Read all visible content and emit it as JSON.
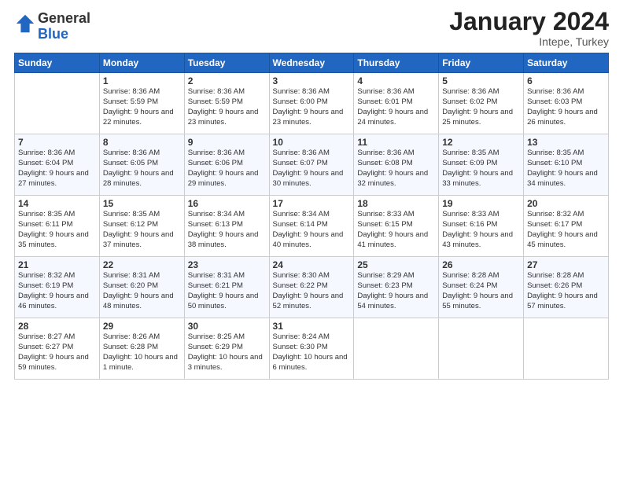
{
  "header": {
    "logo_general": "General",
    "logo_blue": "Blue",
    "month_title": "January 2024",
    "subtitle": "Intepe, Turkey"
  },
  "columns": [
    "Sunday",
    "Monday",
    "Tuesday",
    "Wednesday",
    "Thursday",
    "Friday",
    "Saturday"
  ],
  "weeks": [
    [
      {
        "day": "",
        "empty": true
      },
      {
        "day": "1",
        "sunrise": "Sunrise: 8:36 AM",
        "sunset": "Sunset: 5:59 PM",
        "daylight": "Daylight: 9 hours and 22 minutes."
      },
      {
        "day": "2",
        "sunrise": "Sunrise: 8:36 AM",
        "sunset": "Sunset: 5:59 PM",
        "daylight": "Daylight: 9 hours and 23 minutes."
      },
      {
        "day": "3",
        "sunrise": "Sunrise: 8:36 AM",
        "sunset": "Sunset: 6:00 PM",
        "daylight": "Daylight: 9 hours and 23 minutes."
      },
      {
        "day": "4",
        "sunrise": "Sunrise: 8:36 AM",
        "sunset": "Sunset: 6:01 PM",
        "daylight": "Daylight: 9 hours and 24 minutes."
      },
      {
        "day": "5",
        "sunrise": "Sunrise: 8:36 AM",
        "sunset": "Sunset: 6:02 PM",
        "daylight": "Daylight: 9 hours and 25 minutes."
      },
      {
        "day": "6",
        "sunrise": "Sunrise: 8:36 AM",
        "sunset": "Sunset: 6:03 PM",
        "daylight": "Daylight: 9 hours and 26 minutes."
      }
    ],
    [
      {
        "day": "7",
        "sunrise": "Sunrise: 8:36 AM",
        "sunset": "Sunset: 6:04 PM",
        "daylight": "Daylight: 9 hours and 27 minutes."
      },
      {
        "day": "8",
        "sunrise": "Sunrise: 8:36 AM",
        "sunset": "Sunset: 6:05 PM",
        "daylight": "Daylight: 9 hours and 28 minutes."
      },
      {
        "day": "9",
        "sunrise": "Sunrise: 8:36 AM",
        "sunset": "Sunset: 6:06 PM",
        "daylight": "Daylight: 9 hours and 29 minutes."
      },
      {
        "day": "10",
        "sunrise": "Sunrise: 8:36 AM",
        "sunset": "Sunset: 6:07 PM",
        "daylight": "Daylight: 9 hours and 30 minutes."
      },
      {
        "day": "11",
        "sunrise": "Sunrise: 8:36 AM",
        "sunset": "Sunset: 6:08 PM",
        "daylight": "Daylight: 9 hours and 32 minutes."
      },
      {
        "day": "12",
        "sunrise": "Sunrise: 8:35 AM",
        "sunset": "Sunset: 6:09 PM",
        "daylight": "Daylight: 9 hours and 33 minutes."
      },
      {
        "day": "13",
        "sunrise": "Sunrise: 8:35 AM",
        "sunset": "Sunset: 6:10 PM",
        "daylight": "Daylight: 9 hours and 34 minutes."
      }
    ],
    [
      {
        "day": "14",
        "sunrise": "Sunrise: 8:35 AM",
        "sunset": "Sunset: 6:11 PM",
        "daylight": "Daylight: 9 hours and 35 minutes."
      },
      {
        "day": "15",
        "sunrise": "Sunrise: 8:35 AM",
        "sunset": "Sunset: 6:12 PM",
        "daylight": "Daylight: 9 hours and 37 minutes."
      },
      {
        "day": "16",
        "sunrise": "Sunrise: 8:34 AM",
        "sunset": "Sunset: 6:13 PM",
        "daylight": "Daylight: 9 hours and 38 minutes."
      },
      {
        "day": "17",
        "sunrise": "Sunrise: 8:34 AM",
        "sunset": "Sunset: 6:14 PM",
        "daylight": "Daylight: 9 hours and 40 minutes."
      },
      {
        "day": "18",
        "sunrise": "Sunrise: 8:33 AM",
        "sunset": "Sunset: 6:15 PM",
        "daylight": "Daylight: 9 hours and 41 minutes."
      },
      {
        "day": "19",
        "sunrise": "Sunrise: 8:33 AM",
        "sunset": "Sunset: 6:16 PM",
        "daylight": "Daylight: 9 hours and 43 minutes."
      },
      {
        "day": "20",
        "sunrise": "Sunrise: 8:32 AM",
        "sunset": "Sunset: 6:17 PM",
        "daylight": "Daylight: 9 hours and 45 minutes."
      }
    ],
    [
      {
        "day": "21",
        "sunrise": "Sunrise: 8:32 AM",
        "sunset": "Sunset: 6:19 PM",
        "daylight": "Daylight: 9 hours and 46 minutes."
      },
      {
        "day": "22",
        "sunrise": "Sunrise: 8:31 AM",
        "sunset": "Sunset: 6:20 PM",
        "daylight": "Daylight: 9 hours and 48 minutes."
      },
      {
        "day": "23",
        "sunrise": "Sunrise: 8:31 AM",
        "sunset": "Sunset: 6:21 PM",
        "daylight": "Daylight: 9 hours and 50 minutes."
      },
      {
        "day": "24",
        "sunrise": "Sunrise: 8:30 AM",
        "sunset": "Sunset: 6:22 PM",
        "daylight": "Daylight: 9 hours and 52 minutes."
      },
      {
        "day": "25",
        "sunrise": "Sunrise: 8:29 AM",
        "sunset": "Sunset: 6:23 PM",
        "daylight": "Daylight: 9 hours and 54 minutes."
      },
      {
        "day": "26",
        "sunrise": "Sunrise: 8:28 AM",
        "sunset": "Sunset: 6:24 PM",
        "daylight": "Daylight: 9 hours and 55 minutes."
      },
      {
        "day": "27",
        "sunrise": "Sunrise: 8:28 AM",
        "sunset": "Sunset: 6:26 PM",
        "daylight": "Daylight: 9 hours and 57 minutes."
      }
    ],
    [
      {
        "day": "28",
        "sunrise": "Sunrise: 8:27 AM",
        "sunset": "Sunset: 6:27 PM",
        "daylight": "Daylight: 9 hours and 59 minutes."
      },
      {
        "day": "29",
        "sunrise": "Sunrise: 8:26 AM",
        "sunset": "Sunset: 6:28 PM",
        "daylight": "Daylight: 10 hours and 1 minute."
      },
      {
        "day": "30",
        "sunrise": "Sunrise: 8:25 AM",
        "sunset": "Sunset: 6:29 PM",
        "daylight": "Daylight: 10 hours and 3 minutes."
      },
      {
        "day": "31",
        "sunrise": "Sunrise: 8:24 AM",
        "sunset": "Sunset: 6:30 PM",
        "daylight": "Daylight: 10 hours and 6 minutes."
      },
      {
        "day": "",
        "empty": true
      },
      {
        "day": "",
        "empty": true
      },
      {
        "day": "",
        "empty": true
      }
    ]
  ]
}
